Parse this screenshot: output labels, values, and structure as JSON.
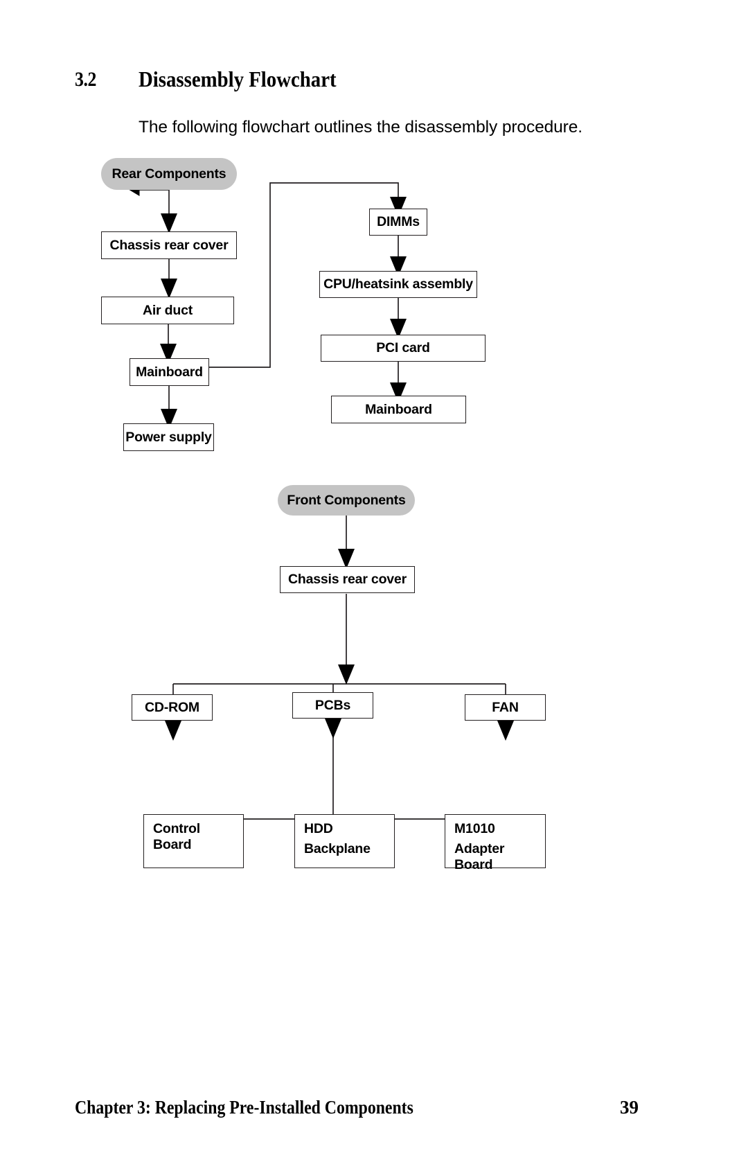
{
  "page": {
    "section_number": "3.2",
    "section_title": "Disassembly Flowchart",
    "intro": "The following flowchart outlines the disassembly procedure.",
    "footer_chapter": "Chapter 3: Replacing Pre-Installed Components",
    "footer_page": "39"
  },
  "colors": {
    "pill_fill": "#c4c4c4",
    "line": "#231f20",
    "box_fill": "#ffffff",
    "text": "#000000"
  },
  "chart_data": {
    "type": "diagram",
    "title": "Disassembly Flowchart",
    "diagrams": [
      {
        "name": "rear-components",
        "root": "Rear Components",
        "nodes": [
          {
            "id": "rear_start",
            "label": "Rear Components",
            "shape": "pill"
          },
          {
            "id": "rear_chassis",
            "label": "Chassis rear cover",
            "shape": "box"
          },
          {
            "id": "rear_airduct",
            "label": "Air duct",
            "shape": "box"
          },
          {
            "id": "rear_mainboard",
            "label": "Mainboard",
            "shape": "box"
          },
          {
            "id": "rear_power",
            "label": "Power supply",
            "shape": "box"
          },
          {
            "id": "dimms",
            "label": "DIMMs",
            "shape": "box"
          },
          {
            "id": "cpu",
            "label": "CPU/heatsink assembly",
            "shape": "box"
          },
          {
            "id": "pci",
            "label": "PCI card",
            "shape": "box"
          },
          {
            "id": "mainboard2",
            "label": "Mainboard",
            "shape": "box"
          }
        ],
        "edges": [
          {
            "from": "rear_start",
            "to": "rear_chassis",
            "style": "straight"
          },
          {
            "from": "rear_chassis",
            "to": "rear_airduct",
            "style": "straight"
          },
          {
            "from": "rear_airduct",
            "to": "rear_mainboard",
            "style": "straight"
          },
          {
            "from": "rear_mainboard",
            "to": "rear_power",
            "style": "straight"
          },
          {
            "from": "rear_mainboard",
            "to": "dimms",
            "style": "elbow"
          },
          {
            "from": "dimms",
            "to": "cpu",
            "style": "straight"
          },
          {
            "from": "cpu",
            "to": "pci",
            "style": "straight"
          },
          {
            "from": "pci",
            "to": "mainboard2",
            "style": "straight"
          }
        ]
      },
      {
        "name": "front-components",
        "root": "Front Components",
        "nodes": [
          {
            "id": "front_start",
            "label": "Front Components",
            "shape": "pill"
          },
          {
            "id": "front_chassis",
            "label": "Chassis rear cover",
            "shape": "box"
          },
          {
            "id": "cdrom",
            "label": "CD-ROM",
            "shape": "box"
          },
          {
            "id": "pcbs",
            "label": "PCBs",
            "shape": "box"
          },
          {
            "id": "fan",
            "label": "FAN",
            "shape": "box"
          },
          {
            "id": "control_board",
            "label": "Control Board",
            "lines": [
              "Control",
              "Board"
            ],
            "shape": "box"
          },
          {
            "id": "hdd_backplane",
            "label": "HDD Backplane",
            "lines": [
              "HDD",
              "Backplane"
            ],
            "shape": "box"
          },
          {
            "id": "m1010",
            "label": "M1010 Adapter Board",
            "lines": [
              "M1010",
              "Adapter Board"
            ],
            "shape": "box"
          }
        ],
        "edges": [
          {
            "from": "front_start",
            "to": "front_chassis",
            "style": "straight"
          },
          {
            "from": "front_chassis",
            "to": "bus1",
            "style": "straight"
          },
          {
            "from": "bus1",
            "to": "cdrom",
            "style": "branch"
          },
          {
            "from": "bus1",
            "to": "pcbs",
            "style": "branch"
          },
          {
            "from": "bus1",
            "to": "fan",
            "style": "branch"
          },
          {
            "from": "pcbs",
            "to": "bus2",
            "style": "straight-no-arrow"
          },
          {
            "from": "bus2",
            "to": "control_board",
            "style": "branch"
          },
          {
            "from": "bus2",
            "to": "hdd_backplane",
            "style": "branch"
          },
          {
            "from": "bus2",
            "to": "m1010",
            "style": "branch"
          }
        ]
      }
    ]
  },
  "rear": {
    "start": "Rear Components",
    "chassis": "Chassis rear cover",
    "airduct": "Air duct",
    "mainboard": "Mainboard",
    "power": "Power supply",
    "dimms": "DIMMs",
    "cpu": "CPU/heatsink assembly",
    "pci": "PCI card",
    "mainboard2": "Mainboard"
  },
  "front": {
    "start": "Front Components",
    "chassis": "Chassis rear cover",
    "cdrom": "CD-ROM",
    "pcbs": "PCBs",
    "fan": "FAN",
    "control_l1": "Control",
    "control_l2": "Board",
    "hdd_l1": "HDD",
    "hdd_l2": "Backplane",
    "m1010_l1": "M1010",
    "m1010_l2": "Adapter Board"
  }
}
